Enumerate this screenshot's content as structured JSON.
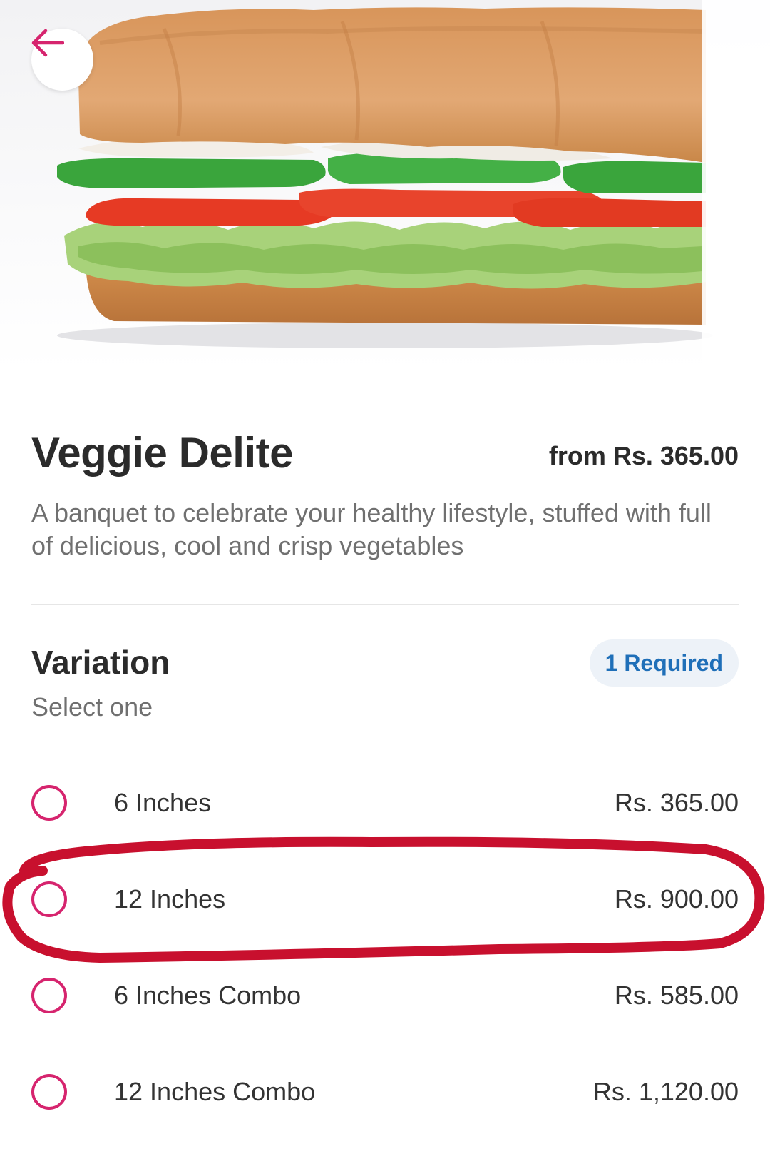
{
  "product": {
    "name": "Veggie Delite",
    "from_price": "from Rs. 365.00",
    "description": "A banquet to celebrate your healthy lifestyle, stuffed with full of delicious, cool and crisp vegetables"
  },
  "variation": {
    "title": "Variation",
    "subtitle": "Select one",
    "badge": "1 Required",
    "options": [
      {
        "label": "6 Inches",
        "price": "Rs. 365.00"
      },
      {
        "label": "12 Inches",
        "price": "Rs. 900.00"
      },
      {
        "label": "6 Inches Combo",
        "price": "Rs. 585.00"
      },
      {
        "label": "12 Inches Combo",
        "price": "Rs. 1,120.00"
      }
    ]
  },
  "icons": {
    "back": "arrow-left-icon",
    "radio": "radio-unchecked-icon"
  },
  "colors": {
    "accent": "#d6246e",
    "badge_text": "#1f6fb8",
    "badge_bg": "#edf2f8",
    "annotation": "#c8102e"
  }
}
